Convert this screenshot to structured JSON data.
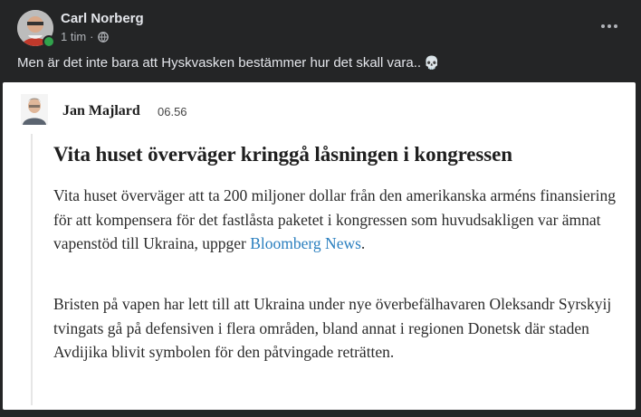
{
  "post": {
    "author": "Carl Norberg",
    "time": "1 tim",
    "separator": "·",
    "text": "Men är det inte bara att Hyskvasken bestämmer hur det skall vara..",
    "emoji": "💀",
    "icons": [
      "globe-icon",
      "more-options-icon",
      "skull-emoji"
    ]
  },
  "quoted": {
    "author": "Jan Majlard",
    "time": "06.56",
    "headline": "Vita huset överväger kringgå låsningen i kongressen",
    "para1_text": "Vita huset överväger att ta 200 miljoner dollar från den amerikanska arméns finansiering för att kompensera för det fastlåsta paketet i kongressen som huvudsakligen var ämnat vapenstöd till Ukraina, uppger ",
    "para1_link": "Bloomberg News",
    "para1_end": ".",
    "para2": "Bristen på vapen har lett till att Ukraina under nye överbefälhavaren Oleksandr Syrskyij tvingats gå på defensiven i flera områden, bland annat i regionen Donetsk där staden Avdijika blivit symbolen för den påtvingade reträtten."
  },
  "colors": {
    "page_bg": "#242526",
    "text_primary": "#e4e6eb",
    "text_secondary": "#b0b3b8",
    "online": "#31a24c",
    "link": "#2a7fbf"
  }
}
